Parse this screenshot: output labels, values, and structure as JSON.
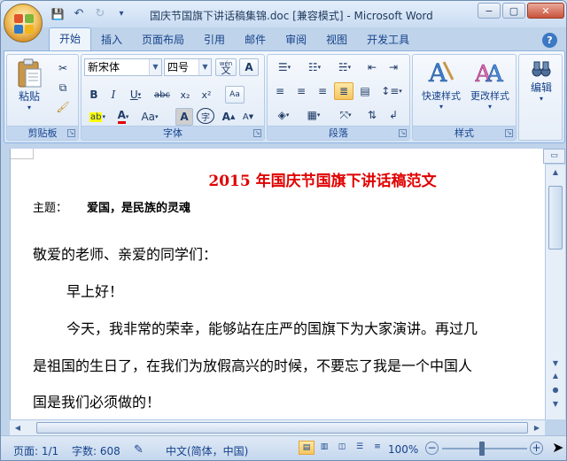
{
  "window": {
    "title": "国庆节国旗下讲话稿集锦.doc [兼容模式] - Microsoft Word",
    "controls": {
      "minimize": "−",
      "maximize": "▢",
      "close": "✕"
    }
  },
  "qat": {
    "save": "💾",
    "undo": "↶",
    "redo": "↻",
    "more": "▾"
  },
  "tabs": [
    "开始",
    "插入",
    "页面布局",
    "引用",
    "邮件",
    "审阅",
    "视图",
    "开发工具"
  ],
  "active_tab": "开始",
  "help": "?",
  "ribbon": {
    "clipboard": {
      "label": "剪贴板",
      "paste": "粘贴"
    },
    "font": {
      "label": "字体",
      "font_name": "新宋体",
      "font_size": "四号",
      "wen": "wén\n文",
      "a_box": "A",
      "bold": "B",
      "italic": "I",
      "underline": "U",
      "strike": "abc",
      "subscript": "x₂",
      "superscript": "x²",
      "clear": "Aa",
      "highlight": "ab",
      "color": "A",
      "case": "Aa",
      "shade": "A",
      "circle": "字",
      "grow": "A",
      "shrink": "A"
    },
    "paragraph": {
      "label": "段落"
    },
    "styles": {
      "label": "样式",
      "quick": "快速样式",
      "change": "更改样式"
    },
    "editing": {
      "label": "编辑"
    }
  },
  "document": {
    "title": "2015 年国庆节国旗下讲话稿范文",
    "theme_label": "主题：",
    "theme_value": "爱国，是民族的灵魂",
    "lines": [
      "敬爱的老师、亲爱的同学们：",
      "早上好！",
      "今天，我非常的荣幸，能够站在庄严的国旗下为大家演讲。再过几",
      "是祖国的生日了，在我们为放假高兴的时候，不要忘了我是一个中国人",
      "国是我们必须做的！"
    ]
  },
  "status": {
    "page": "页面: 1/1",
    "words": "字数: 608",
    "language": "中文(简体，中国)",
    "zoom": "100%"
  },
  "colors": {
    "title_red": "#e00000",
    "ribbon_blue": "#15428b"
  }
}
